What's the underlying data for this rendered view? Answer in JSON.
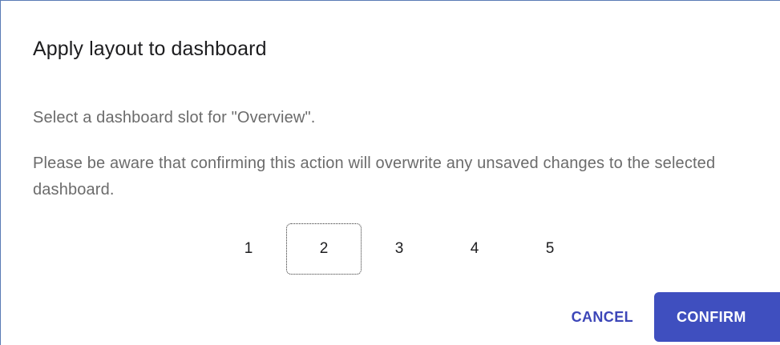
{
  "dialog": {
    "title": "Apply layout to dashboard",
    "slot_prompt": "Select a dashboard slot for \"Overview\".",
    "warning": "Please be aware that confirming this action will overwrite any unsaved changes to the selected dashboard."
  },
  "slots": {
    "options": [
      "1",
      "2",
      "3",
      "4",
      "5"
    ],
    "selected": "2"
  },
  "actions": {
    "cancel_label": "CANCEL",
    "confirm_label": "CONFIRM"
  },
  "colors": {
    "primary": "#3f4fbf",
    "primary_text": "#3c46b8",
    "body_text": "#6b6b6b",
    "title_text": "#1d1d1f"
  }
}
